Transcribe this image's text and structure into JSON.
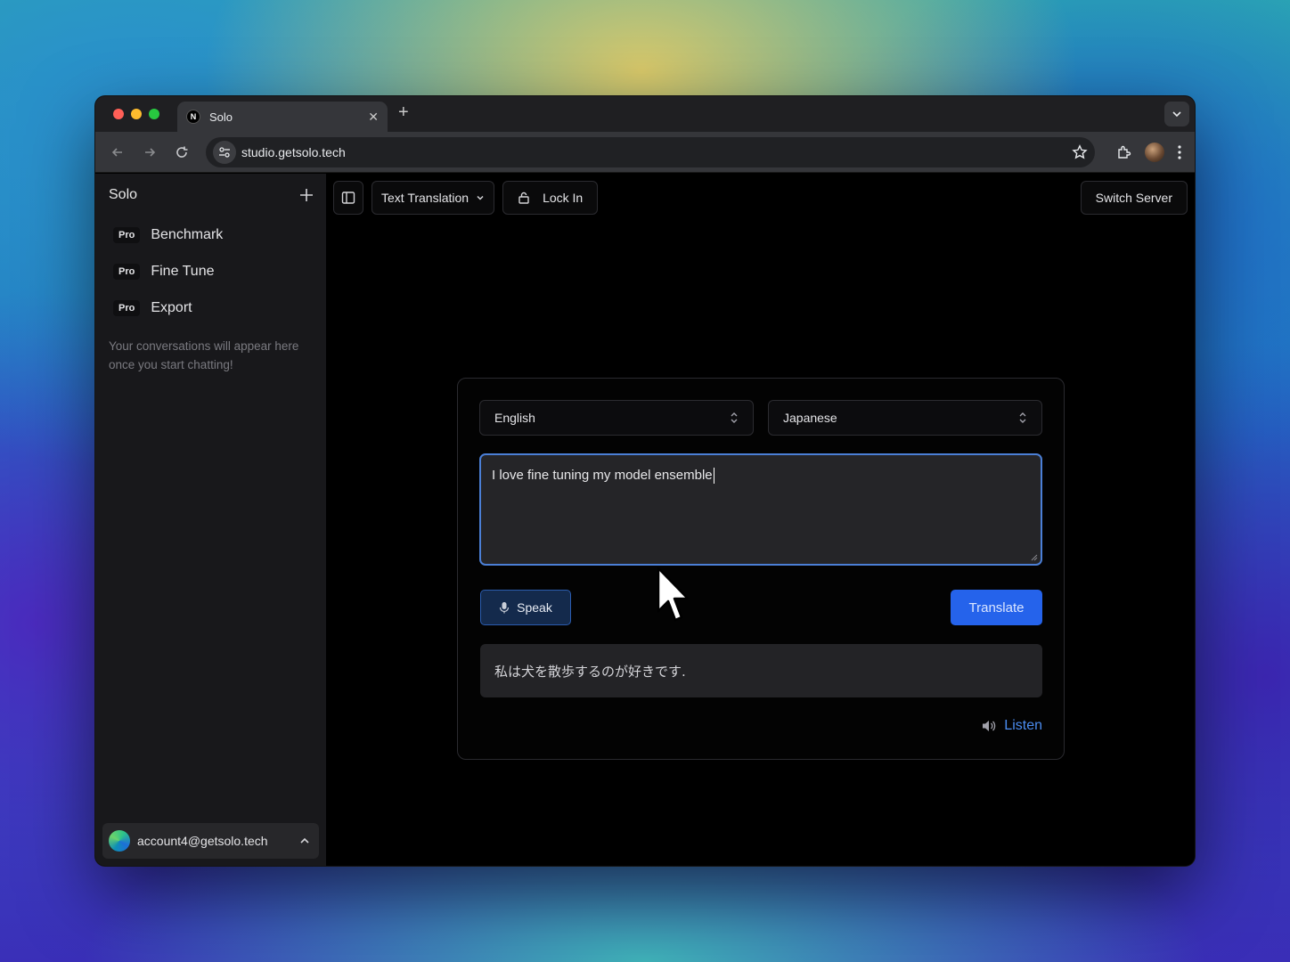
{
  "browser": {
    "tab_title": "Solo",
    "favicon_letter": "N",
    "url": "studio.getsolo.tech"
  },
  "sidebar": {
    "title": "Solo",
    "items": [
      {
        "badge": "Pro",
        "label": "Benchmark"
      },
      {
        "badge": "Pro",
        "label": "Fine Tune"
      },
      {
        "badge": "Pro",
        "label": "Export"
      }
    ],
    "empty_text": "Your conversations will appear here once you start chatting!",
    "account_email": "account4@getsolo.tech"
  },
  "topbar": {
    "mode_label": "Text Translation",
    "lock_label": "Lock In",
    "switch_label": "Switch Server"
  },
  "translator": {
    "source_language": "English",
    "target_language": "Japanese",
    "input_text": "I love fine tuning my model ensemble",
    "speak_label": "Speak",
    "translate_label": "Translate",
    "output_text": "私は犬を散歩するのが好きです.",
    "listen_label": "Listen"
  },
  "colors": {
    "accent": "#2563eb",
    "focus_ring": "#4b7fd6",
    "link": "#4b8cf0"
  }
}
